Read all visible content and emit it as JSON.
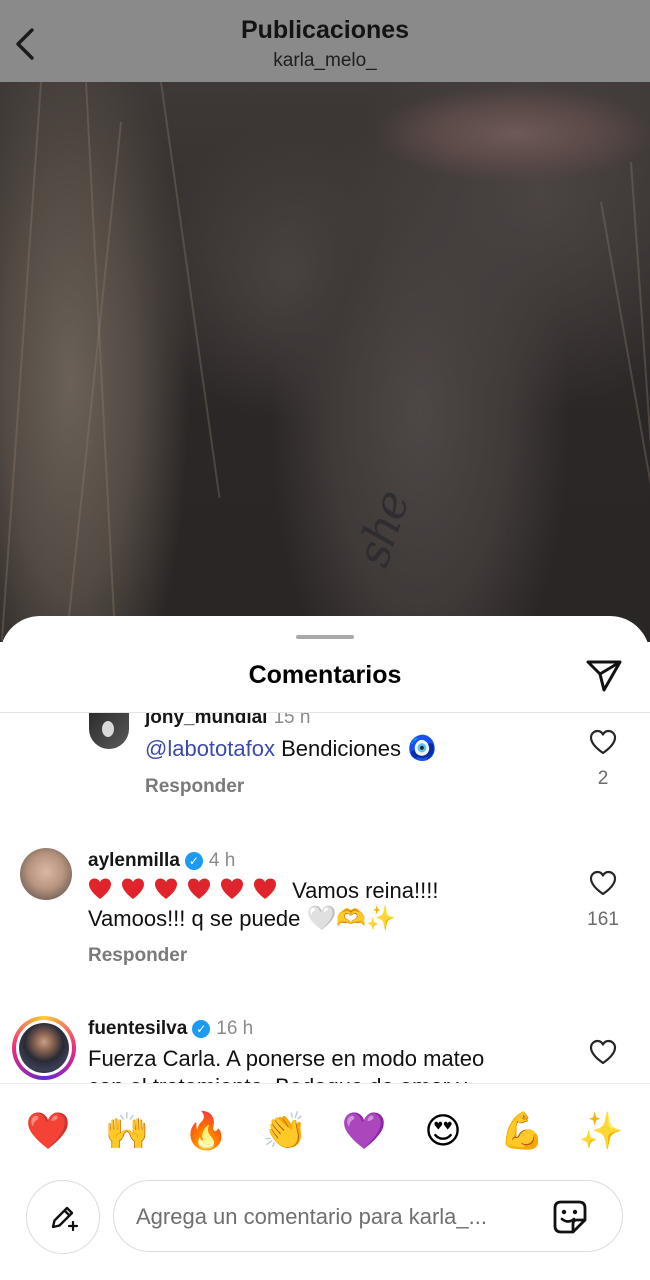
{
  "header": {
    "title": "Publicaciones",
    "username": "karla_melo_"
  },
  "photo": {
    "tattoo_text": "she"
  },
  "sheet": {
    "title": "Comentarios",
    "comments": [
      {
        "user": "jony_mundial",
        "time": "15 h",
        "mention": "@labototafox",
        "text": " Bendiciones",
        "emoji": "🧿",
        "reply": "Responder",
        "likes": "2"
      },
      {
        "user": "aylenmilla",
        "time": "4 h",
        "text_line1": "Vamos reina!!!!",
        "text_line2": "Vamoos!!! q se puede",
        "emoji_line2": "🤍🫶✨",
        "reply": "Responder",
        "likes": "161"
      },
      {
        "user": "fuentesilva",
        "time": "16 h",
        "text_line1": "Fuerza Carla. A ponerse en modo mateo",
        "text_line2": "con el tratamiento. Bodoque de amor y"
      }
    ]
  },
  "reactions": [
    "❤️",
    "🙌",
    "🔥",
    "👏",
    "💜",
    "😍",
    "💪",
    "✨"
  ],
  "composer": {
    "placeholder": "Agrega un comentario para karla_..."
  },
  "colors": {
    "mention": "#3a4bab",
    "verified": "#1d9bf0",
    "header_bg": "#8a8a8a"
  }
}
